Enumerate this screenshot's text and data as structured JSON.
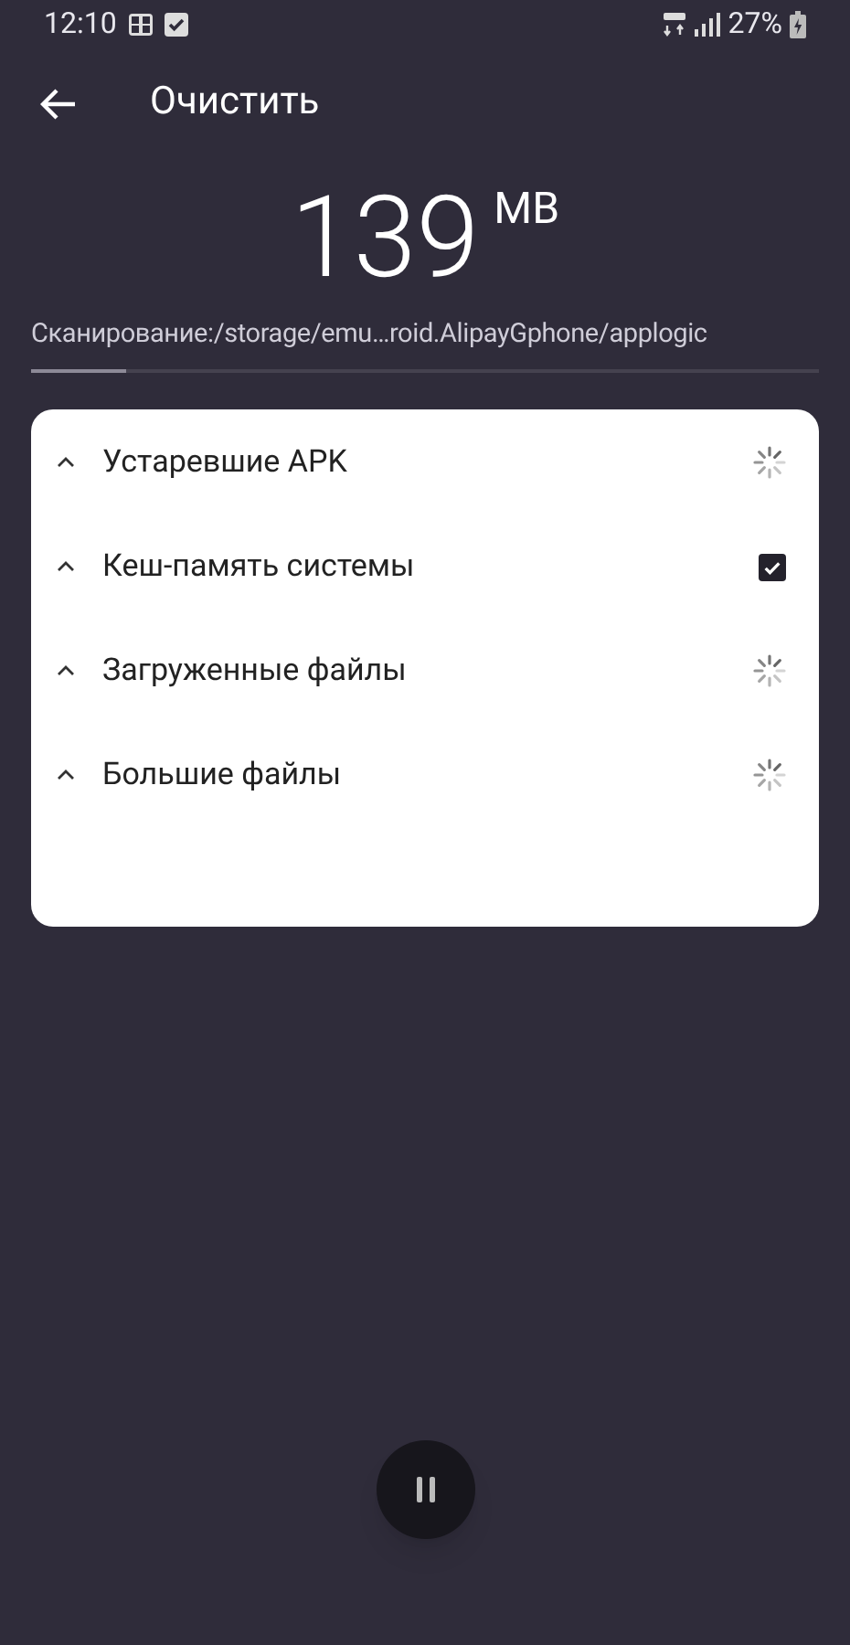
{
  "status_bar": {
    "time": "12:10",
    "battery": "27%"
  },
  "header": {
    "title": "Очистить"
  },
  "scan": {
    "size": "139",
    "unit": "MB",
    "path": "Сканирование:/storage/emu…roid.AlipayGphone/applogic",
    "level": 0.12
  },
  "categories": [
    {
      "label": "Устаревшие APK",
      "kind": "spinner",
      "expanded": false
    },
    {
      "label": "Кеш-память системы",
      "kind": "checkbox",
      "checked": true,
      "expanded": false
    },
    {
      "label": "Загруженные файлы",
      "kind": "spinner",
      "expanded": false
    },
    {
      "label": "Большие файлы",
      "kind": "spinner",
      "expanded": false
    }
  ],
  "pause_button": {
    "paused": false
  }
}
